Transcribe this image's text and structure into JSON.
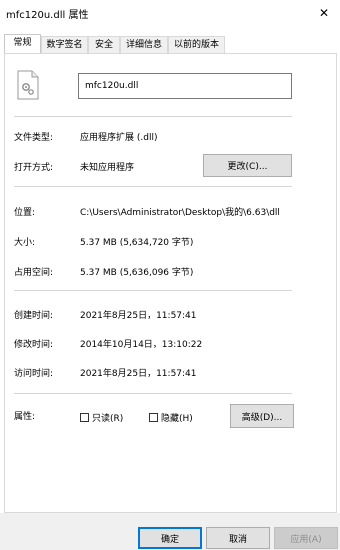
{
  "window": {
    "title": "mfc120u.dll 属性",
    "close_glyph": "✕"
  },
  "tabs": [
    {
      "label": "常规",
      "active": true
    },
    {
      "label": "数字签名"
    },
    {
      "label": "安全"
    },
    {
      "label": "详细信息"
    },
    {
      "label": "以前的版本"
    }
  ],
  "file": {
    "name": "mfc120u.dll",
    "icon": "dll-file-icon"
  },
  "type": {
    "label": "文件类型:",
    "value": "应用程序扩展 (.dll)"
  },
  "opens_with": {
    "label": "打开方式:",
    "value": "未知应用程序",
    "button": "更改(C)..."
  },
  "location": {
    "label": "位置:",
    "value": "C:\\Users\\Administrator\\Desktop\\我的\\6.63\\dll"
  },
  "size": {
    "label": "大小:",
    "value": "5.37 MB (5,634,720 字节)"
  },
  "size_on_disk": {
    "label": "占用空间:",
    "value": "5.37 MB (5,636,096 字节)"
  },
  "created": {
    "label": "创建时间:",
    "value": "2021年8月25日，11:57:41"
  },
  "modified": {
    "label": "修改时间:",
    "value": "2014年10月14日，13:10:22"
  },
  "accessed": {
    "label": "访问时间:",
    "value": "2021年8月25日，11:57:41"
  },
  "attributes": {
    "label": "属性:",
    "readonly": "只读(R)",
    "hidden": "隐藏(H)",
    "advanced": "高级(D)..."
  },
  "footer": {
    "ok": "确定",
    "cancel": "取消",
    "apply": "应用(A)"
  }
}
